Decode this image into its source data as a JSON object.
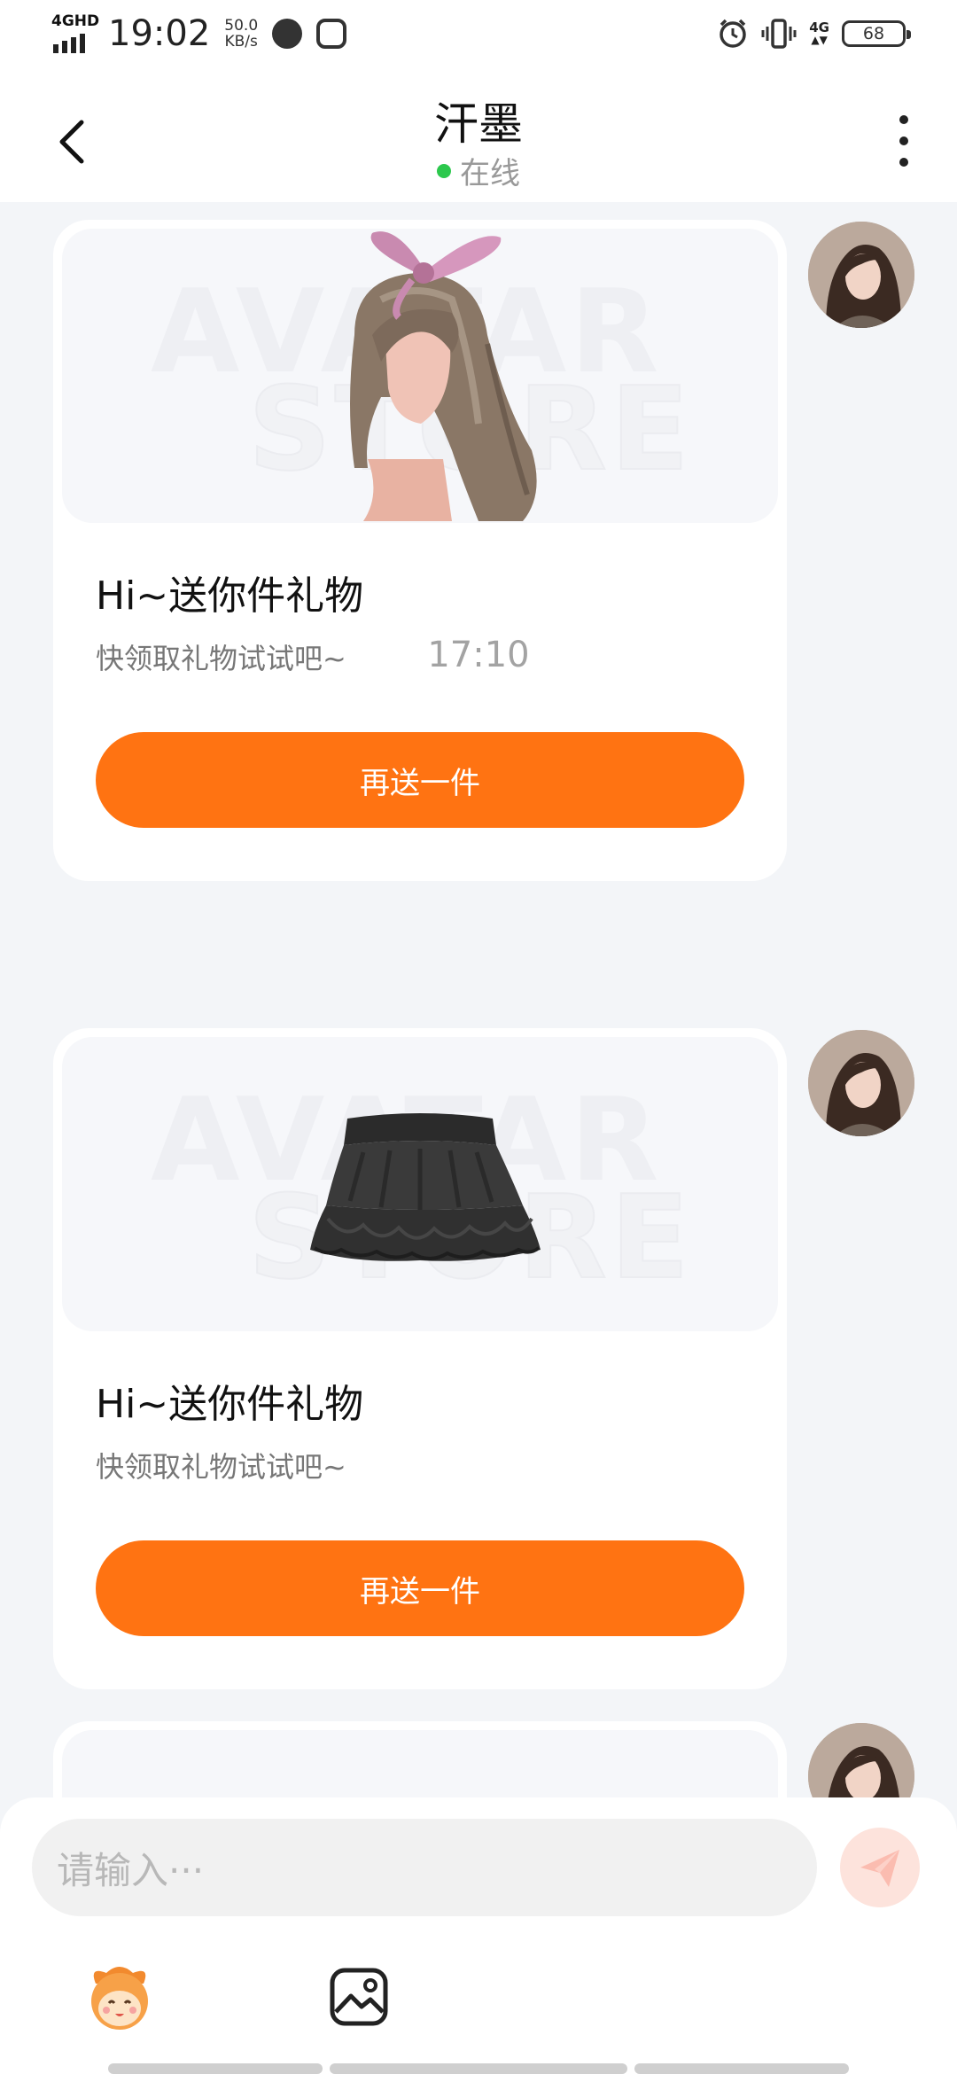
{
  "status_bar": {
    "network_label": "4GHD",
    "time": "19:02",
    "speed_value": "50.0",
    "speed_unit": "KB/s",
    "network_right": "4G",
    "battery": "68"
  },
  "header": {
    "title": "汗墨",
    "status_text": "在线",
    "status_color": "#2cc84d"
  },
  "messages": [
    {
      "item": "hair-with-pink-bow",
      "title": "Hi~送你件礼物",
      "subtitle": "快领取礼物试试吧~",
      "button": "再送一件"
    },
    {
      "item": "black-tiered-skirt",
      "title": "Hi~送你件礼物",
      "subtitle": "快领取礼物试试吧~",
      "button": "再送一件"
    }
  ],
  "time_separator": "17:10",
  "watermark": {
    "line1": "AVATAR",
    "line2": "STORE"
  },
  "composer": {
    "placeholder": "请输入···",
    "send_icon": "send-icon",
    "tools": [
      "emoji-mascot-icon",
      "image-icon"
    ]
  },
  "colors": {
    "accent": "#ff7312",
    "background": "#f3f5f8"
  }
}
